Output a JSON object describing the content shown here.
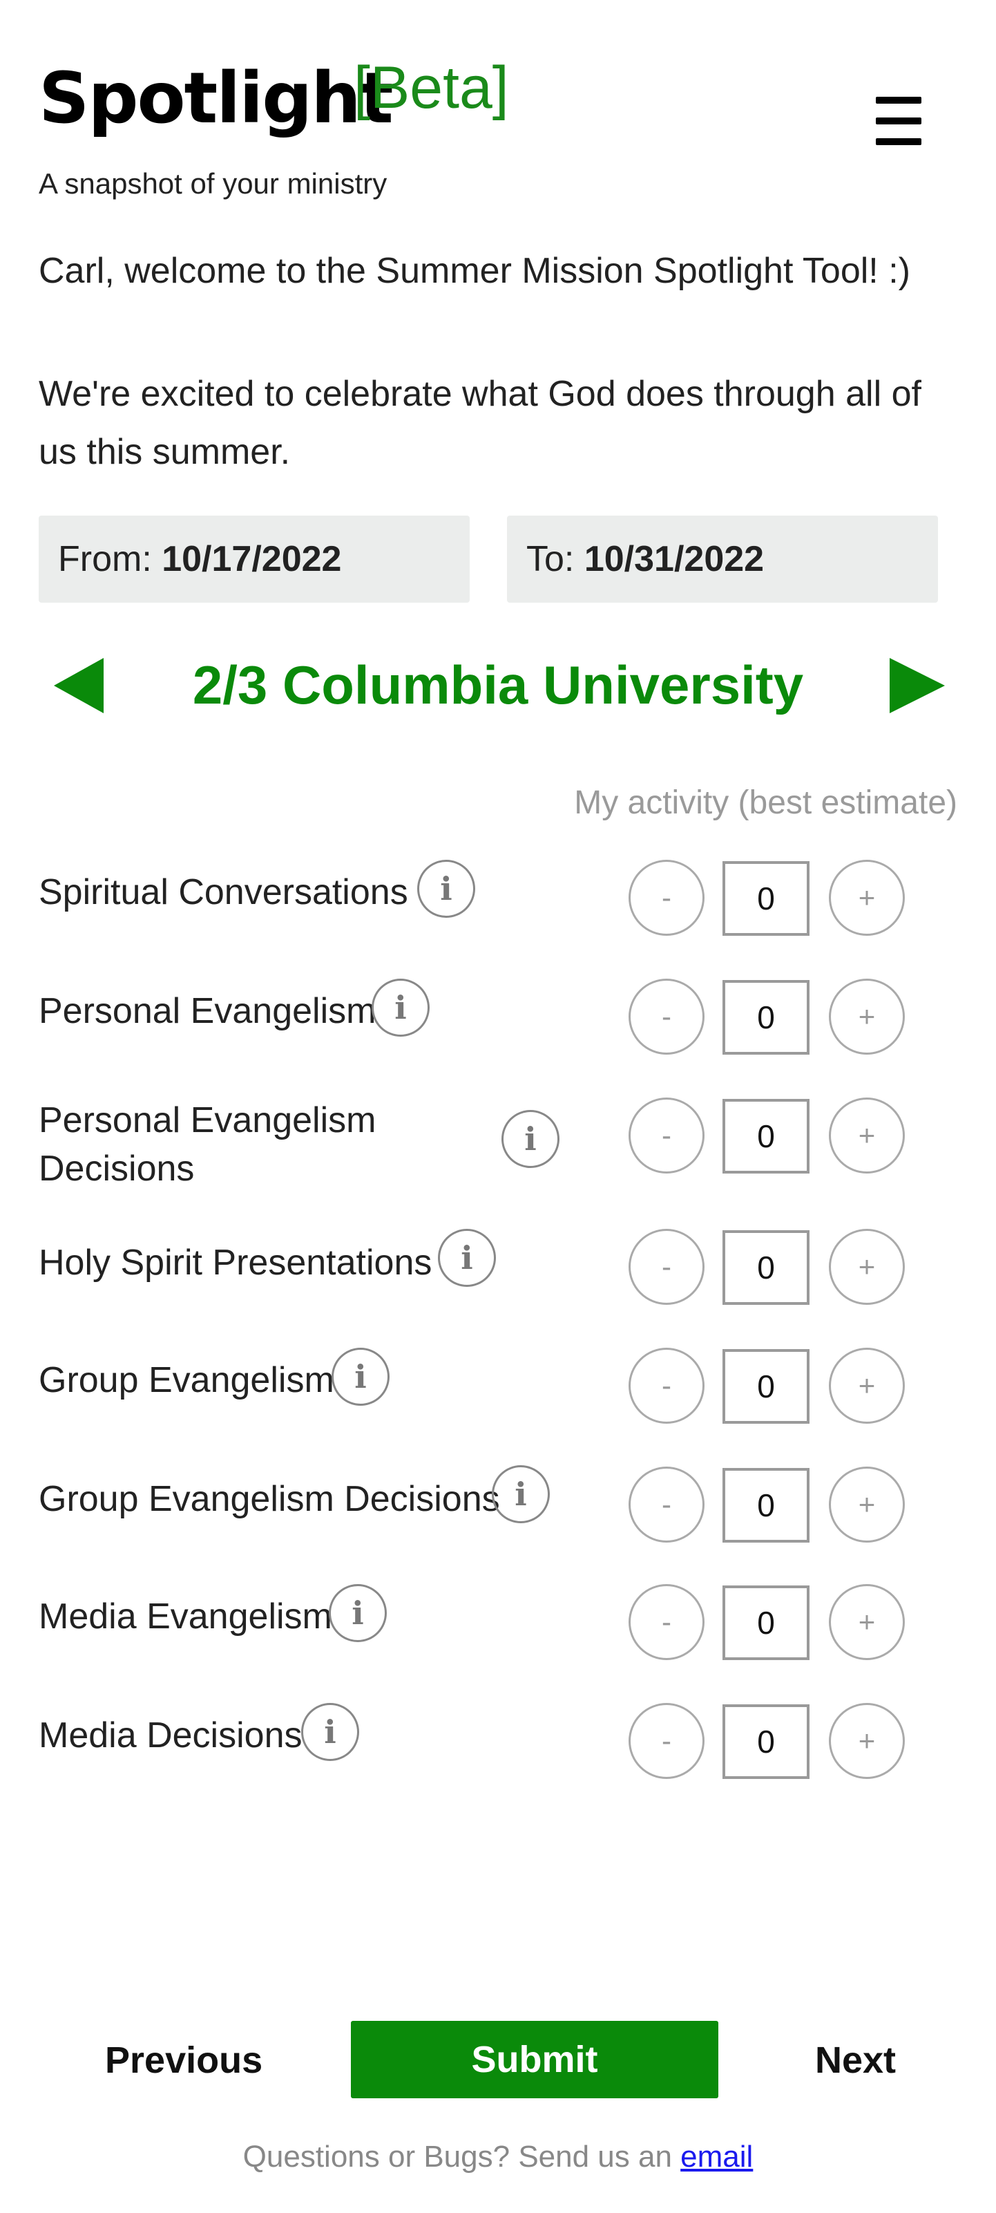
{
  "header": {
    "brand": "Spotlight",
    "beta": "[Beta]",
    "tagline": "A snapshot of your ministry",
    "menu_icon": "hamburger-menu-icon"
  },
  "intro": {
    "welcome": "Carl, welcome to the Summer Mission Spotlight Tool! :)",
    "excited": "We're excited to celebrate what God does through all of us this summer."
  },
  "dates": {
    "from_label": "From:",
    "from_value": "10/17/2022",
    "to_label": "To:",
    "to_value": "10/31/2022"
  },
  "campus": {
    "title": "2/3 Columbia University",
    "prev_icon": "triangle-left-icon",
    "next_icon": "triangle-right-icon"
  },
  "activity_hint": "My activity (best estimate)",
  "metrics": [
    {
      "label": "Spiritual Conversations",
      "value": "0"
    },
    {
      "label": "Personal Evangelism",
      "value": "0"
    },
    {
      "label": "Personal Evangelism Decisions",
      "value": "0"
    },
    {
      "label": "Holy Spirit Presentations",
      "value": "0"
    },
    {
      "label": "Group Evangelism",
      "value": "0"
    },
    {
      "label": "Group Evangelism Decisions",
      "value": "0"
    },
    {
      "label": "Media Evangelism",
      "value": "0"
    },
    {
      "label": "Media Decisions",
      "value": "0"
    }
  ],
  "controls": {
    "info": "i",
    "minus": "-",
    "plus": "+"
  },
  "nav": {
    "previous": "Previous",
    "submit": "Submit",
    "next": "Next"
  },
  "footer": {
    "text": "Questions or Bugs? Send us an ",
    "link": "email"
  },
  "colors": {
    "accent_green": "#0a8a0a",
    "date_box_bg": "#ebedec",
    "link_blue": "#1a1aee"
  }
}
